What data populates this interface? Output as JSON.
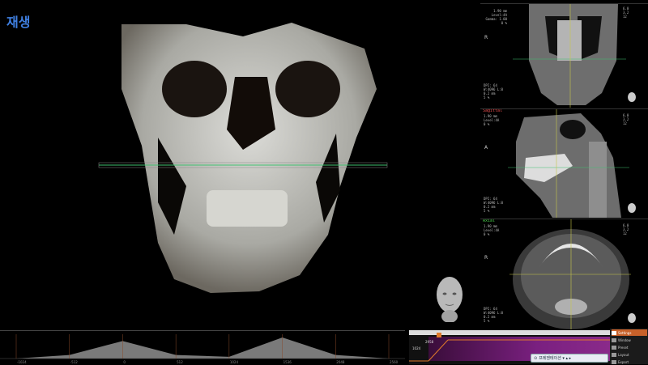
{
  "main_view": {
    "mode_label": "재생"
  },
  "panels": {
    "coronal": {
      "title": "",
      "top_info": "1.90 mm\nLevel:4A\nGamma: 1.00\n0 %",
      "left_info": "R",
      "right_info": "6.0\n3.2\n12",
      "bottom_info": "DPI: 64\nW:4096 L:0\n0.2 mm\n5 %"
    },
    "sagittal": {
      "title": "Sagittal",
      "top_info": "1.90 mm\nLevel:4A\n0 %",
      "left_info": "A",
      "right_info": "6.0\n3.2\n12",
      "bottom_info": "DPI: 64\nW:4096 L:0\n0.2 mm\n5 %"
    },
    "axial": {
      "title": "Axial",
      "top_info": "1.90 mm\nLevel:4A\n0 %",
      "left_info": "R",
      "right_info": "6.0\n3.2\n12",
      "bottom_info": "DPI: 64\nW:4096 L:0\n0.2 mm\n5 %"
    }
  },
  "timeline": {
    "ticks": [
      "-1024",
      "-512",
      "0",
      "512",
      "1024",
      "1536",
      "2048",
      "2560"
    ]
  },
  "tf_editor": {
    "label_top": "2958",
    "label_mid": "1024"
  },
  "preset_bar": {
    "label": "프레젠테이션 ▾ ▴ ▸"
  },
  "right_menu": {
    "items": [
      "Settings",
      "Window",
      "Preset",
      "Layout",
      "Export"
    ]
  },
  "colors": {
    "accent": "#c8612a",
    "mode_label": "#3f7fe0",
    "ramp": "#7a2080"
  },
  "chart_data": {
    "type": "area",
    "title": "",
    "xlabel": "",
    "ylabel": "",
    "x": [
      -1024,
      -512,
      0,
      512,
      1024,
      1536,
      2048,
      2560
    ],
    "series": [
      {
        "values": [
          0,
          2,
          10,
          2,
          1,
          12,
          2,
          0
        ]
      }
    ]
  }
}
